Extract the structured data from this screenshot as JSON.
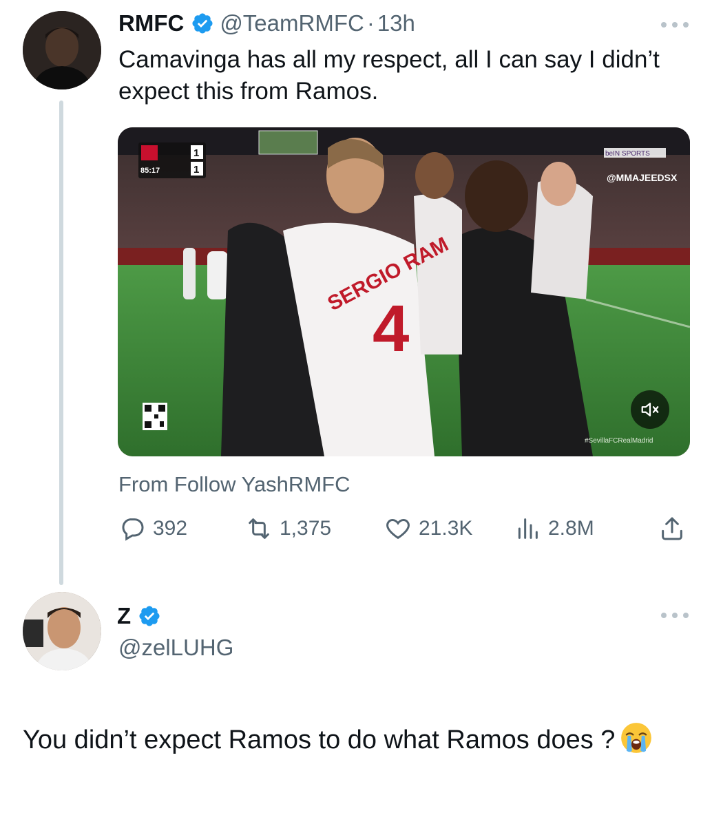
{
  "tweet": {
    "author_name": "RMFC",
    "handle": "@TeamRMFC",
    "separator": "·",
    "time": "13h",
    "text": "Camavinga has all my respect, all I can say I didn’t expect this from Ramos.",
    "media": {
      "scoreboard_time": "85:17",
      "score_home": "1",
      "score_away": "1",
      "broadcaster": "beIN SPORTS",
      "watermark": "@MMAJEEDSX",
      "jersey_name": "SERGIO RAM",
      "jersey_number": "4",
      "hashtag": "#SevillaFCRealMadrid"
    },
    "from_line": "From Follow YashRMFC",
    "stats": {
      "replies": "392",
      "retweets": "1,375",
      "likes": "21.3K",
      "views": "2.8M"
    }
  },
  "reply": {
    "author_name": "Z",
    "handle": "@zelLUHG",
    "text": "You didn’t expect Ramos to do what Ramos does ?",
    "emoji": "loudly-crying-face"
  },
  "colors": {
    "verified": "#1d9bf0",
    "secondary_text": "#536471",
    "thread_line": "#cfd9de",
    "pitch_green": "#3f8a3a"
  }
}
